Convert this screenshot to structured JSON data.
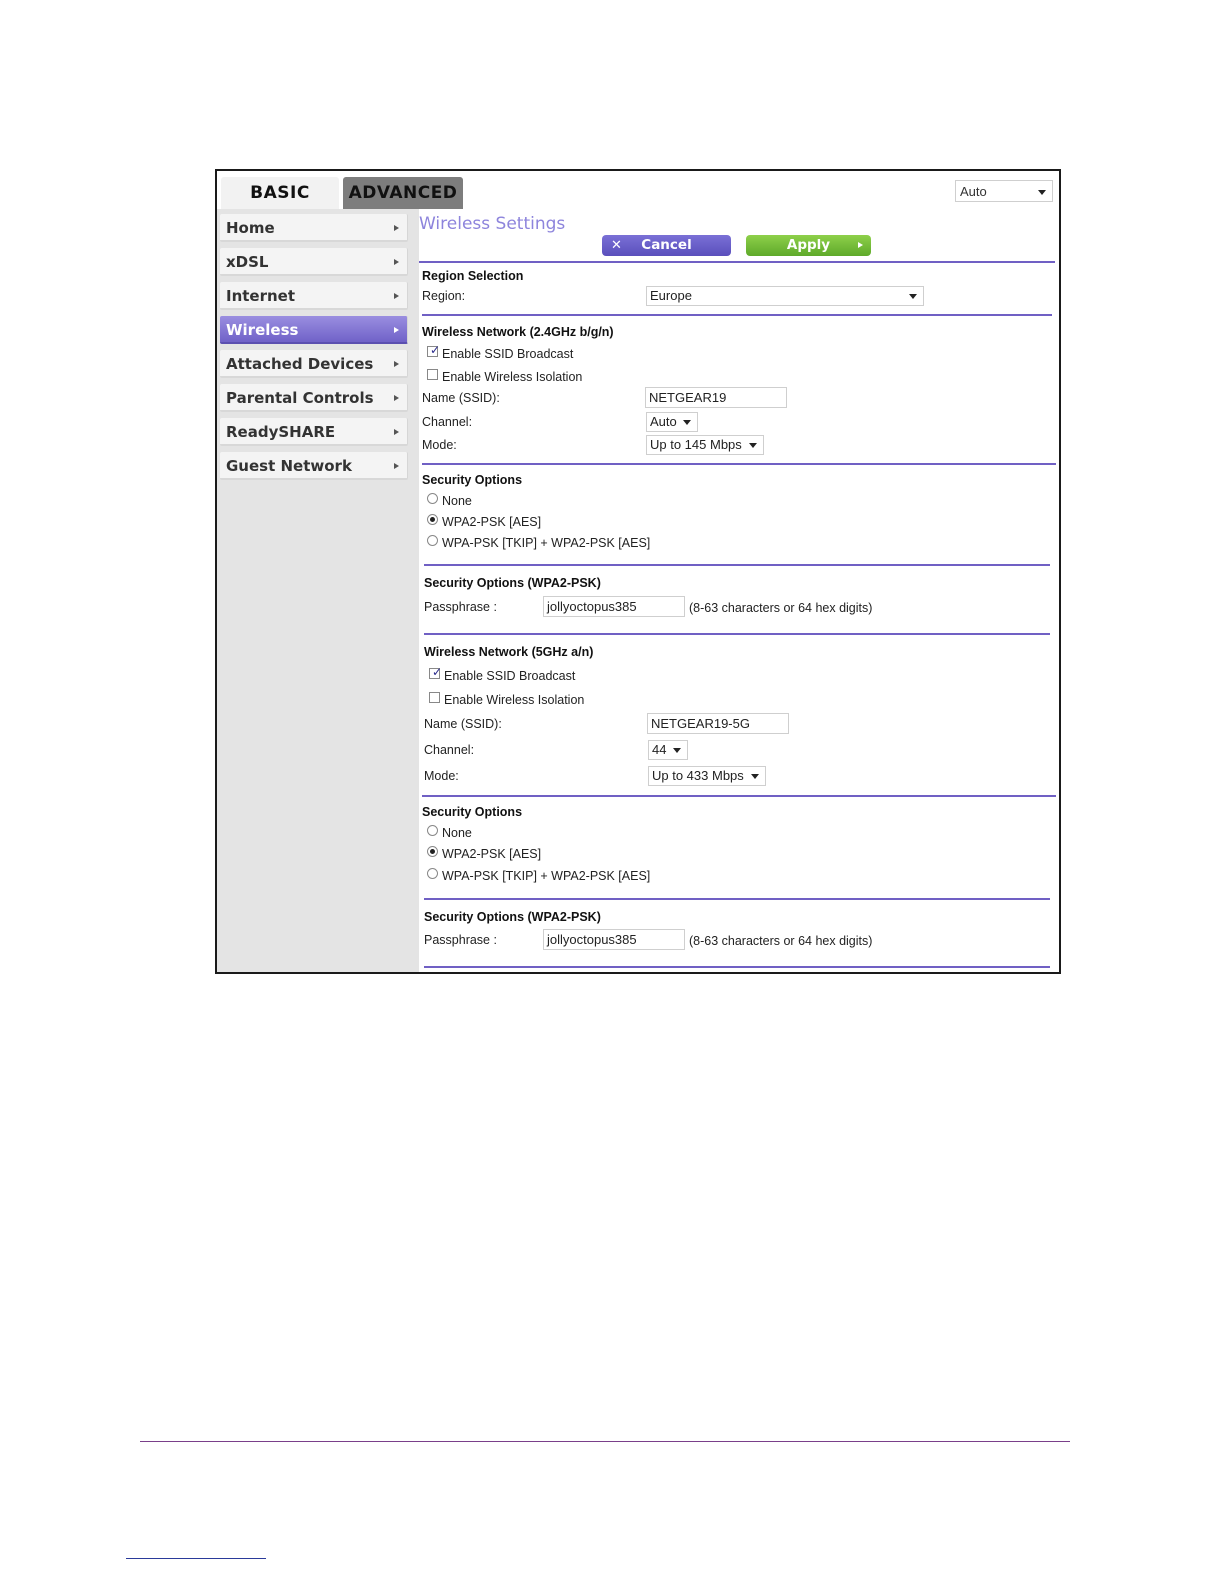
{
  "tabs": {
    "basic": "BASIC",
    "advanced": "ADVANCED"
  },
  "language_select": {
    "value": "Auto"
  },
  "sidebar": {
    "items": [
      {
        "label": "Home"
      },
      {
        "label": "xDSL"
      },
      {
        "label": "Internet"
      },
      {
        "label": "Wireless",
        "active": true
      },
      {
        "label": "Attached Devices"
      },
      {
        "label": "Parental Controls"
      },
      {
        "label": "ReadySHARE"
      },
      {
        "label": "Guest Network"
      }
    ]
  },
  "page": {
    "title": "Wireless Settings",
    "cancel_label": "Cancel",
    "apply_label": "Apply"
  },
  "region": {
    "heading": "Region Selection",
    "label": "Region:",
    "value": "Europe"
  },
  "net24": {
    "heading": "Wireless Network (2.4GHz b/g/n)",
    "ssid_broadcast_label": "Enable SSID Broadcast",
    "ssid_broadcast_checked": true,
    "isolation_label": "Enable Wireless Isolation",
    "isolation_checked": false,
    "name_label": "Name (SSID):",
    "name_value": "NETGEAR19",
    "channel_label": "Channel:",
    "channel_value": "Auto",
    "mode_label": "Mode:",
    "mode_value": "Up to 145 Mbps"
  },
  "sec24": {
    "heading": "Security Options",
    "options": [
      "None",
      "WPA2-PSK [AES]",
      "WPA-PSK [TKIP] + WPA2-PSK [AES]"
    ],
    "selected": "WPA2-PSK [AES]"
  },
  "psk24": {
    "heading": "Security Options (WPA2-PSK)",
    "label": "Passphrase :",
    "value": "jollyoctopus385",
    "hint": "(8-63 characters or 64 hex digits)"
  },
  "net5": {
    "heading": "Wireless Network (5GHz a/n)",
    "ssid_broadcast_label": "Enable SSID Broadcast",
    "ssid_broadcast_checked": true,
    "isolation_label": "Enable Wireless Isolation",
    "isolation_checked": false,
    "name_label": "Name (SSID):",
    "name_value": "NETGEAR19-5G",
    "channel_label": "Channel:",
    "channel_value": "44",
    "mode_label": "Mode:",
    "mode_value": "Up to 433 Mbps"
  },
  "sec5": {
    "heading": "Security Options",
    "options": [
      "None",
      "WPA2-PSK [AES]",
      "WPA-PSK [TKIP] + WPA2-PSK [AES]"
    ],
    "selected": "WPA2-PSK [AES]"
  },
  "psk5": {
    "heading": "Security Options (WPA2-PSK)",
    "label": "Passphrase :",
    "value": "jollyoctopus385",
    "hint": "(8-63 characters or 64 hex digits)"
  },
  "colors": {
    "accent": "#7060c4",
    "title": "#8d84dc",
    "apply_green": "#6cb535"
  }
}
